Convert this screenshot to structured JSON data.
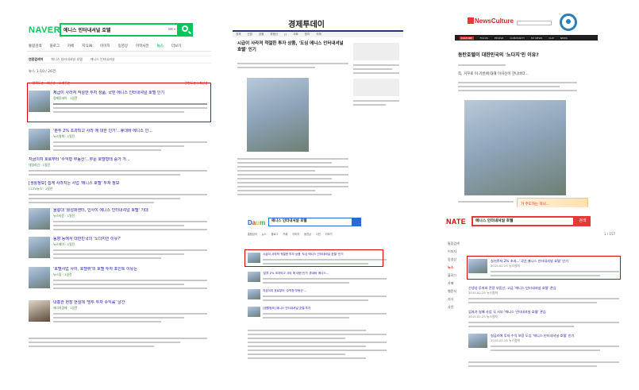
{
  "naver": {
    "logo": "NAVER",
    "query": "에니스 인터내셔널 호텔",
    "tabs": [
      "통합검색",
      "블로그",
      "카페",
      "지식iN",
      "이미지",
      "동영상",
      "어학사전",
      "뉴스",
      "더보기"
    ],
    "active_tab": "뉴스",
    "filters": [
      "연관검색어",
      "에니스 인터내셔널 호텔",
      "에니스 인터내셔널"
    ],
    "count_label": "뉴스  1-10 / 26건",
    "sort_label": "✓ 정확도순 · 최신순 · 오래된순",
    "sort_right": "관련도순 | 최신순",
    "items": [
      {
        "title": "제급이 사라져 적절한 투자 상품, 국민 에니스 인터내셔널 호텔 인기",
        "meta": "경제투데이 · 1일전"
      },
      {
        "title": "'분투 2% 초과되고 사라 에 대한 인기'...휴대바 에니스 인...",
        "meta": "뉴스컬쳐 · 1일전"
      },
      {
        "title": "자금이여 호로부터 '수익형 부동산'...부문 호텔형태 증가 가...",
        "meta": "데일리안 · 1일전"
      },
      {
        "title": "[생활정보] 쉽게 사라지는 사업 '에니스 호텔' 투자 정보",
        "meta": "CCTV뉴스 · 1일전"
      },
      {
        "title": "울릉대 '활성화센터, 인사이 에니스 인터내셔널 호텔' 기대",
        "meta": "뉴스타운 · 1일전"
      },
      {
        "title": "동향 등에서 대한민국의 '노다지인 이유?'",
        "meta": "뉴스웨이 · 1일전"
      },
      {
        "title": "'호텔사업 사이, 호텔뷰'의 호텔 투자 포인트 이유는",
        "meta": "뉴스핌 · 1일전"
      },
      {
        "title": "내홍한 현장 현실에 '방투 투자 수익률' 낭간",
        "meta": "에너지경제 · 1일전"
      }
    ]
  },
  "etoday": {
    "logo": "경제투데이",
    "nav": [
      "경제",
      "산업",
      "금융",
      "부동산",
      "IT",
      "사회",
      "정치",
      "국제"
    ],
    "headline": "시급이 사라져 적절한 투자 상품, '도심 에니스 인터내셔널 호텔' 인기"
  },
  "newsculture": {
    "logo": "NewsCulture",
    "nav": [
      "CULTURE",
      "FOCUS",
      "PEOPLE",
      "COMMUNITY",
      "MY NEWS",
      "CLIP",
      "NEWS"
    ],
    "active_nav": "CULTURE",
    "title": "동탄호텔이 대한민국의 '노다지'인 이유?",
    "lead": "즉, 거꾸로 이 기반에 대해 이사신이 한나바다...",
    "ad": "가 주도하는 하나..."
  },
  "daum": {
    "logo_parts": [
      "D",
      "a",
      "u",
      "m"
    ],
    "query": "에니스 인터내셔널 호텔",
    "tabs": [
      "통합검색",
      "뉴스",
      "블로그",
      "카페",
      "이미지",
      "동영상",
      "사전",
      "더보기"
    ],
    "items": [
      "시급이 사라져 적절한 투자 상품 '도심 에니스 인터내셔널 호텔' 인기",
      "'분투 2% 초과되고 사라 에 대한 인기' 휴대바 에니스...",
      "자금이여 호로부터 '수익형 부동산'...",
      "[생활정보] 에니스 인터내셔널 호텔 투자"
    ]
  },
  "nate": {
    "logo": "NATE",
    "query": "에니스 인터내셔널 호텔",
    "button": "검색",
    "left_menu": [
      "통합검색",
      "이미지",
      "동영상",
      "뉴스",
      "블로그",
      "카페",
      "웹문서",
      "지식",
      "사전"
    ],
    "active_menu": "뉴스",
    "count_label": "1 / 157",
    "items": [
      {
        "title": "실거주자 2% 초과...'국민 에니스 인터내셔널 호텔' 인기",
        "meta": "2015.02.25  뉴스컬쳐"
      },
      {
        "title": "선생성 투자와 전망 부동산, 고급 '에니스 인터내셔널 호텔' 관심",
        "meta": "2015.02.25  뉴스컬쳐"
      },
      {
        "title": "업자가 실패 사업 국 시부 '에니스 인터내셔널 호텔' 관심",
        "meta": "2015.02.25  뉴스컬쳐"
      },
      {
        "title": "실금리에 투자 수익 보장 도심 '에니스 인터내셔널 호텔' 인기",
        "meta": "2015.02.25  뉴스컬쳐"
      }
    ]
  },
  "colors": {
    "naver_green": "#03c75a",
    "nate_red": "#e53935",
    "highlight_red": "#d50000",
    "link_blue": "#1a0dab"
  }
}
